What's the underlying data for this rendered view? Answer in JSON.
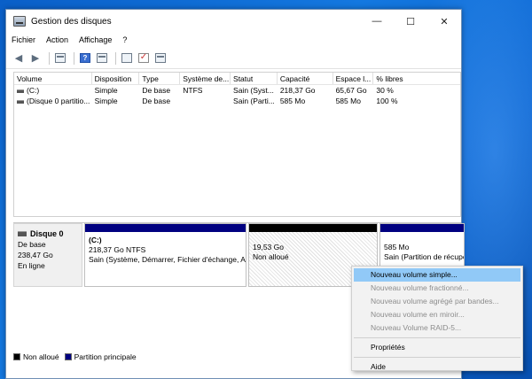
{
  "window": {
    "title": "Gestion des disques",
    "controls": {
      "minimize": "—",
      "maximize": "☐",
      "close": "✕"
    }
  },
  "menu": [
    "Fichier",
    "Action",
    "Affichage",
    "?"
  ],
  "toolbar": {
    "icons": [
      "back-arrow-icon",
      "forward-arrow-icon",
      "properties-icon",
      "help-icon",
      "volume-list-icon",
      "rescan-icon",
      "check-icon",
      "settings-icon"
    ]
  },
  "volumes_table": {
    "columns": [
      "Volume",
      "Disposition",
      "Type",
      "Système de...",
      "Statut",
      "Capacité",
      "Espace l...",
      "% libres"
    ],
    "rows": [
      [
        "(C:)",
        "Simple",
        "De base",
        "NTFS",
        "Sain (Syst...",
        "218,37 Go",
        "65,67 Go",
        "30 %"
      ],
      [
        "(Disque 0 partitio...",
        "Simple",
        "De base",
        "",
        "Sain (Parti...",
        "585 Mo",
        "585 Mo",
        "100 %"
      ]
    ]
  },
  "disk": {
    "name": "Disque 0",
    "type": "De base",
    "size": "238,47 Go",
    "status": "En ligne",
    "partitions": [
      {
        "cap_color": "#000080",
        "label": "(C:)",
        "size": "218,37 Go NTFS",
        "status": "Sain (Système, Démarrer, Fichier d'échange, Acti"
      },
      {
        "cap_color": "#000000",
        "label": "",
        "size": "19,53 Go",
        "status": "Non alloué"
      },
      {
        "cap_color": "#000080",
        "label": "",
        "size": "585 Mo",
        "status": "Sain (Partition de récupé"
      }
    ]
  },
  "legend": [
    {
      "color": "#000000",
      "label": "Non alloué"
    },
    {
      "color": "#000080",
      "label": "Partition principale"
    }
  ],
  "context_menu": {
    "items": [
      {
        "label": "Nouveau volume simple...",
        "enabled": true,
        "highlighted": true
      },
      {
        "label": "Nouveau volume fractionné...",
        "enabled": false
      },
      {
        "label": "Nouveau volume agrégé par bandes...",
        "enabled": false
      },
      {
        "label": "Nouveau volume en miroir...",
        "enabled": false
      },
      {
        "label": "Nouveau Volume RAID-5...",
        "enabled": false
      },
      {
        "label": "Propriétés",
        "enabled": true
      },
      {
        "label": "Aide",
        "enabled": true
      }
    ]
  }
}
